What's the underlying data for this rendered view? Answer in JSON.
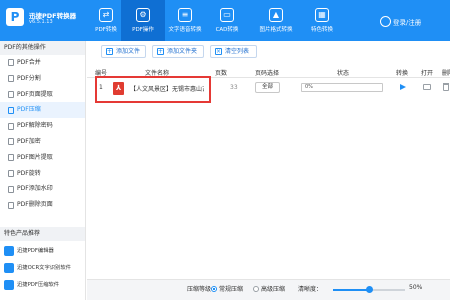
{
  "app": {
    "name": "迅捷PDF转换器",
    "version": "v6.5.1.13",
    "login_label": "登录/注册"
  },
  "nav_tabs": [
    {
      "label": "PDF转换",
      "icon": "pdf-convert-icon"
    },
    {
      "label": "PDF操作",
      "icon": "pdf-operate-icon"
    },
    {
      "label": "文字语音转换",
      "icon": "text-speech-icon"
    },
    {
      "label": "CAD转换",
      "icon": "cad-icon"
    },
    {
      "label": "图片格式转换",
      "icon": "image-icon"
    },
    {
      "label": "特色转换",
      "icon": "feature-icon"
    }
  ],
  "sidebar": {
    "header": "PDF的其他操作",
    "items": [
      {
        "label": "PDF合并"
      },
      {
        "label": "PDF分割"
      },
      {
        "label": "PDF页面提取"
      },
      {
        "label": "PDF压缩"
      },
      {
        "label": "PDF解除密码"
      },
      {
        "label": "PDF加密"
      },
      {
        "label": "PDF图片提取"
      },
      {
        "label": "PDF旋转"
      },
      {
        "label": "PDF添加水印"
      },
      {
        "label": "PDF删除页面"
      }
    ],
    "recommend_header": "特色产品推荐",
    "recommend": [
      {
        "label": "迅捷PDF编辑器"
      },
      {
        "label": "迅捷OCR文字识别软件"
      },
      {
        "label": "迅捷PDF压缩软件"
      }
    ]
  },
  "toolbar": {
    "add_file": "添加文件",
    "add_folder": "添加文件夹",
    "clear_list": "清空列表"
  },
  "table": {
    "headers": {
      "index": "编号",
      "filename": "文件名称",
      "pages": "页数",
      "range": "页码选择",
      "status": "状态",
      "convert": "转换",
      "open": "打开",
      "delete": "删除"
    },
    "rows": [
      {
        "index": "1",
        "filename": "【人文风景区】无锡市惠山古镇",
        "pages": "33",
        "range": "全部",
        "progress_text": "0%",
        "progress": 0
      }
    ]
  },
  "bottom": {
    "compress_level_label": "压缩等级：",
    "option_normal": "常规压缩",
    "option_high": "高级压缩",
    "clarity_label": "清晰度：",
    "clarity_value": "50%",
    "clarity": 0.5
  },
  "colors": {
    "accent": "#1f8ff5",
    "highlight": "#e53935"
  }
}
